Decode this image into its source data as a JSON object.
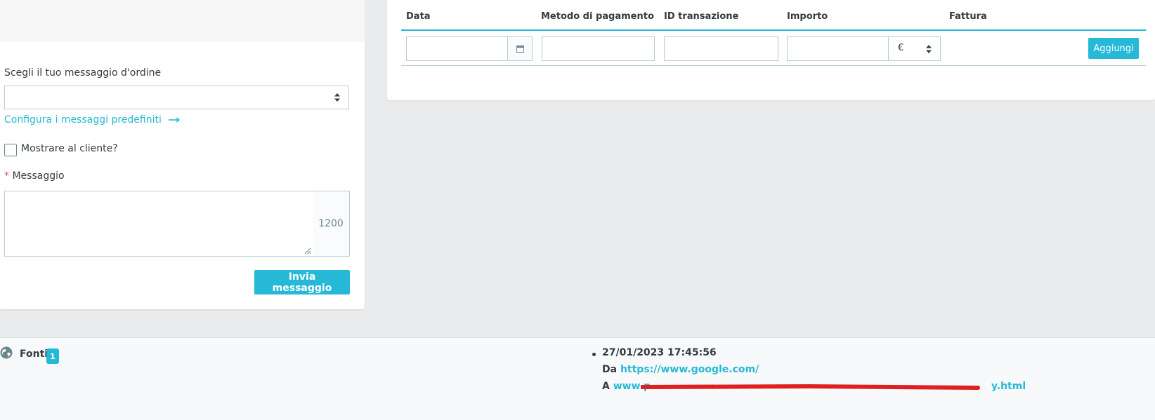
{
  "message_form": {
    "select_label": "Scegli il tuo messaggio d'ordine",
    "select_value": "",
    "configure_link": "Configura i messaggi predefiniti",
    "show_customer_label": "Mostrare al cliente?",
    "show_customer_checked": false,
    "required_mark": "*",
    "message_label": "Messaggio",
    "message_value": "",
    "char_counter": "1200",
    "send_button": "Invia messaggio"
  },
  "payments": {
    "columns": [
      "Data",
      "Metodo di pagamento",
      "ID transazione",
      "Importo",
      "Fattura"
    ],
    "inputs": {
      "date": "",
      "method": "",
      "transaction_id": "",
      "amount": ""
    },
    "currency": "€",
    "add_button": "Aggiungi"
  },
  "sources": {
    "title": "Fonti",
    "count": "1",
    "entries": [
      {
        "datetime": "27/01/2023 17:45:56",
        "from_label": "Da",
        "from_url": "https://www.google.com/",
        "to_label": "A",
        "to_url_start": "www.p",
        "to_url_end": "y.html"
      }
    ]
  },
  "colors": {
    "accent": "#25b9d7",
    "text": "#363a41",
    "border": "#bbcdd2",
    "required": "#c05c67",
    "redaction": "#e0201f"
  }
}
